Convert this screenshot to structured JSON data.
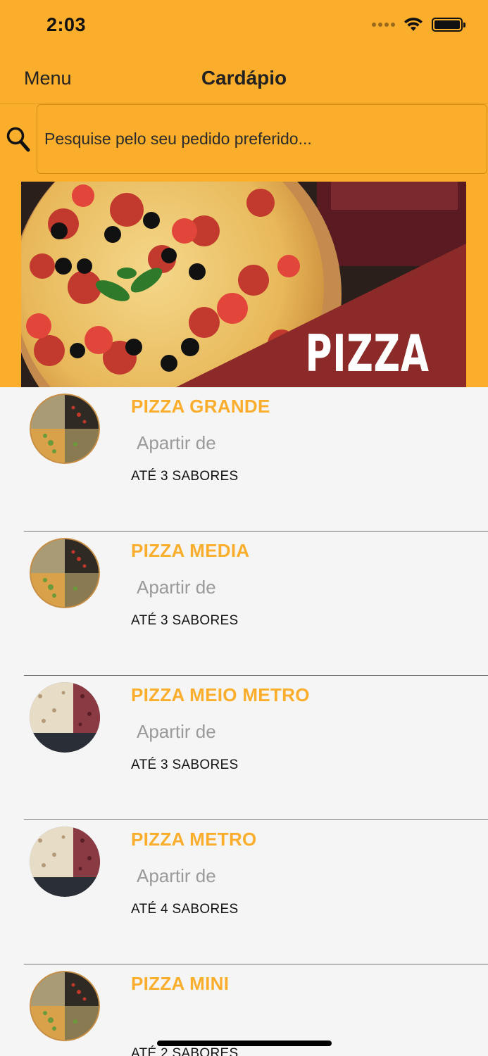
{
  "status_bar": {
    "time": "2:03",
    "icons": [
      "signal-icon",
      "wifi-icon",
      "battery-icon"
    ]
  },
  "nav": {
    "menu_label": "Menu",
    "title": "Cardápio"
  },
  "search": {
    "placeholder": "Pesquise pelo seu pedido preferido...",
    "value": "",
    "icon": "search-icon"
  },
  "banner": {
    "text": "PIZZA"
  },
  "colors": {
    "accent": "#fbad2c",
    "background": "#f5f5f5",
    "banner_red": "#8c2a2a"
  },
  "menu_items": [
    {
      "name": "PIZZA GRANDE",
      "price_label": "Apartir de",
      "flavors": "ATÉ 3 SABORES"
    },
    {
      "name": "PIZZA MEDIA",
      "price_label": "Apartir de",
      "flavors": "ATÉ 3 SABORES"
    },
    {
      "name": "PIZZA MEIO METRO",
      "price_label": "Apartir de",
      "flavors": "ATÉ 3 SABORES"
    },
    {
      "name": "PIZZA METRO",
      "price_label": "Apartir de",
      "flavors": "ATÉ 4 SABORES"
    },
    {
      "name": "PIZZA MINI",
      "price_label": "",
      "flavors": "ATÉ 2 SABORES"
    }
  ]
}
